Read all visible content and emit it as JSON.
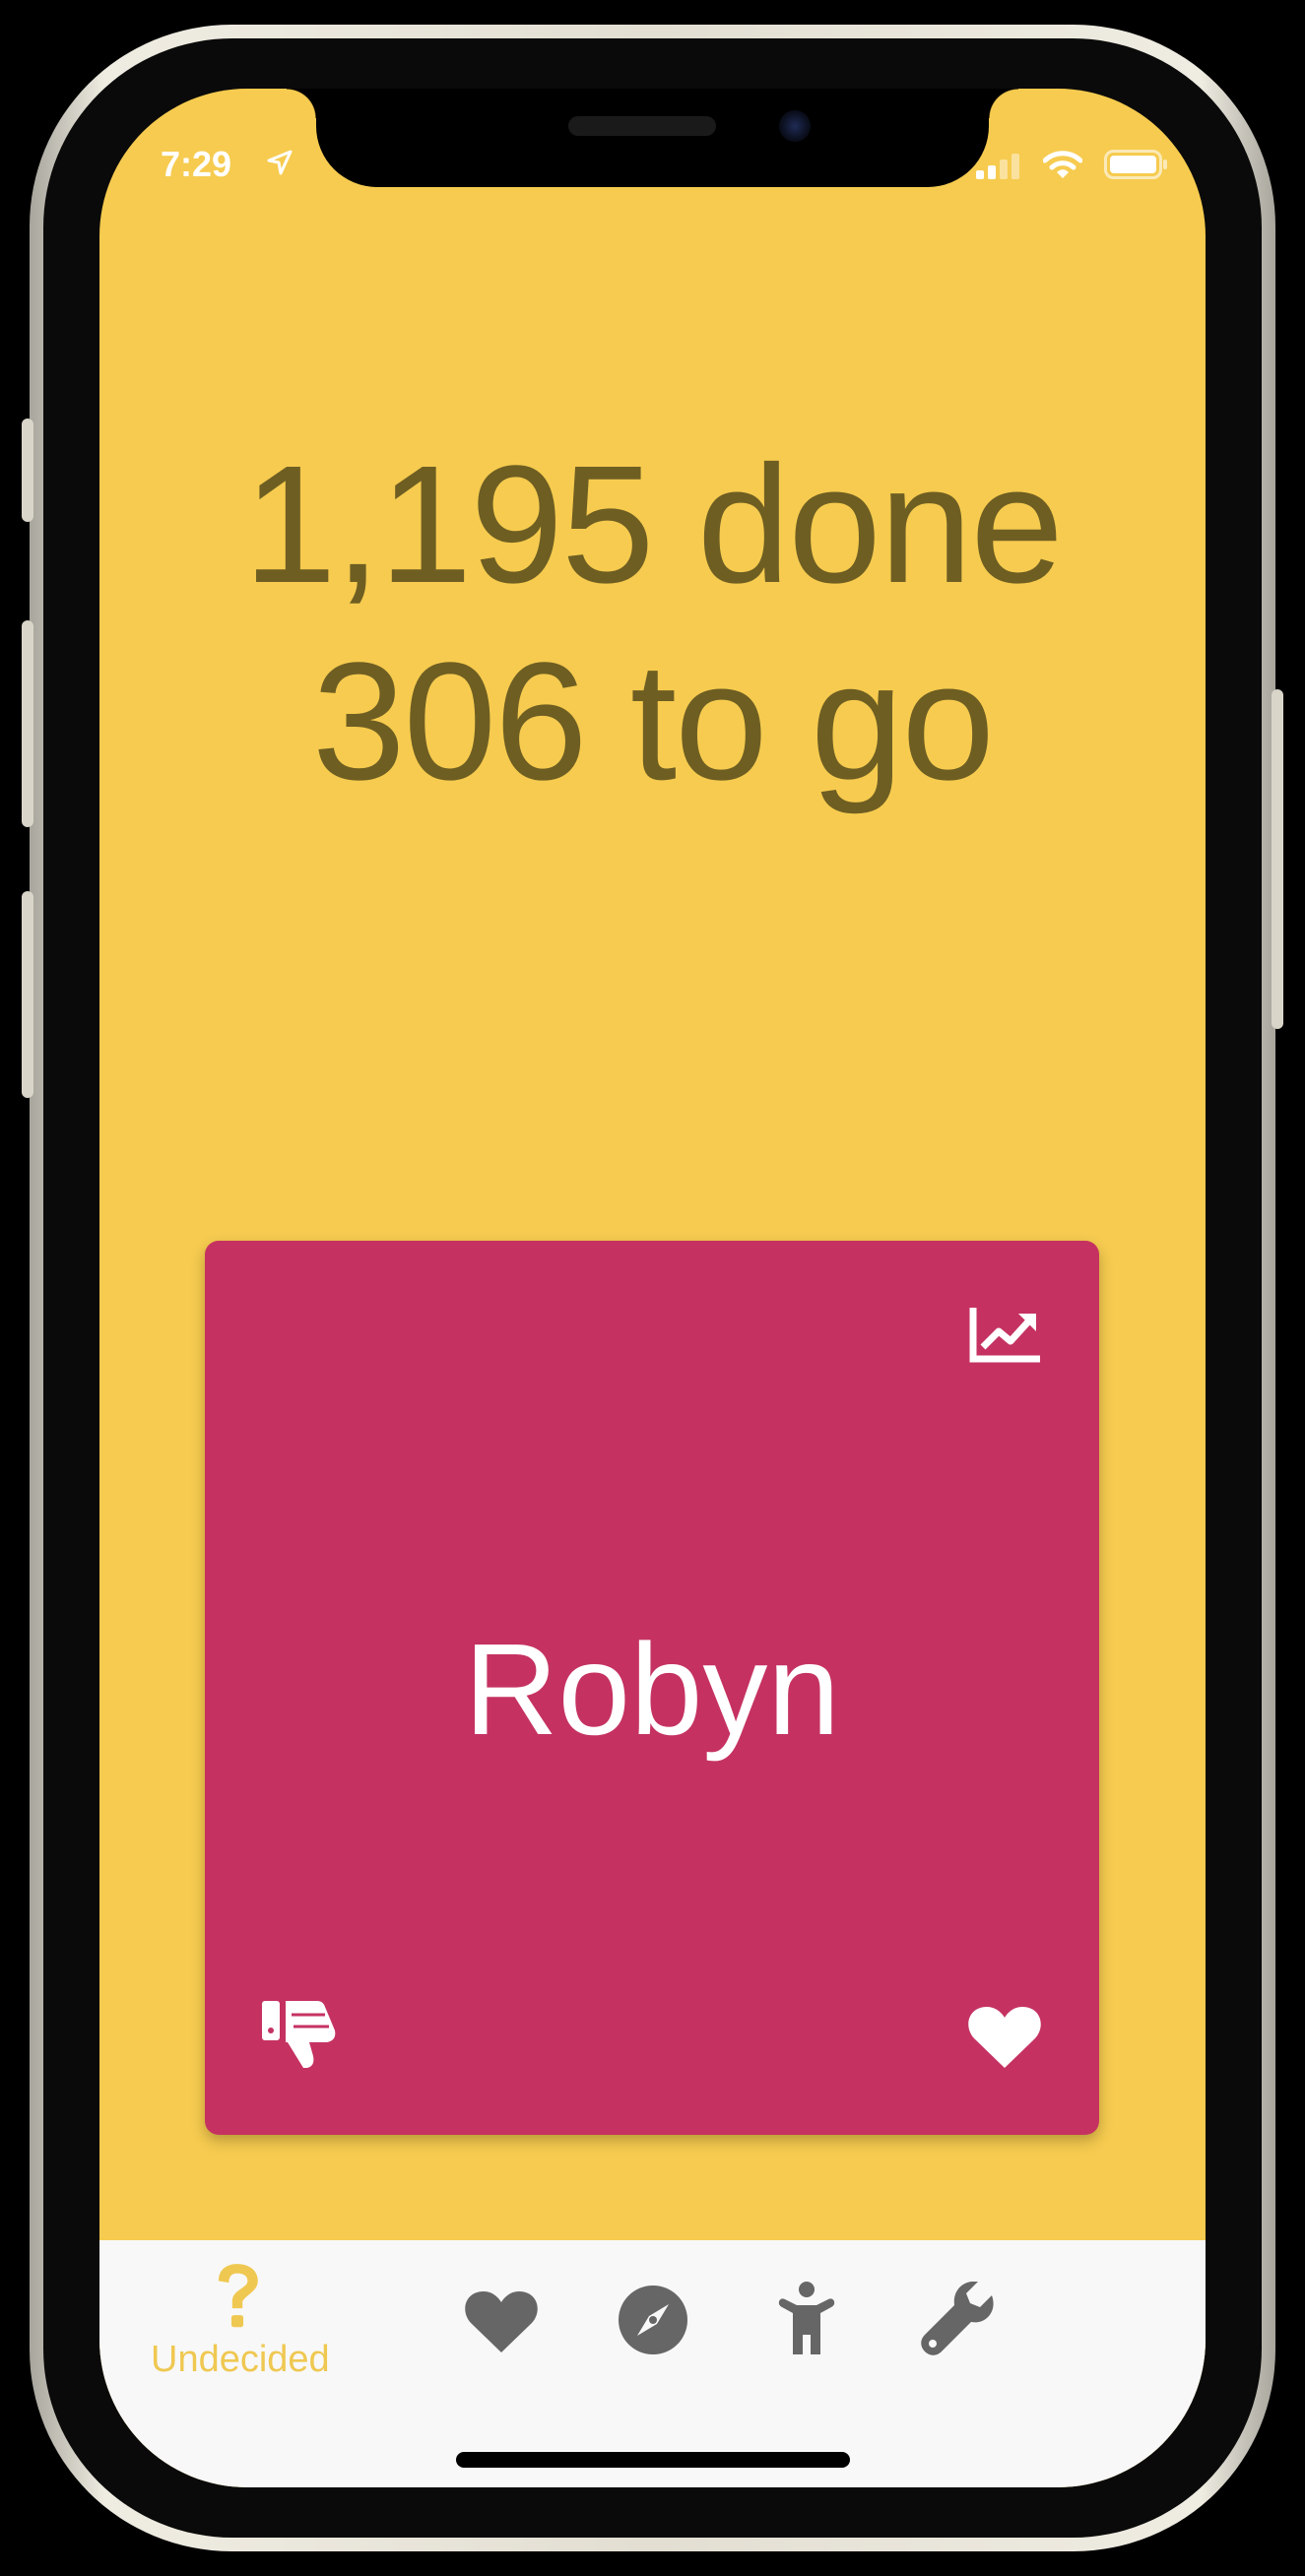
{
  "status_bar": {
    "time": "7:29",
    "icons": [
      "location-arrow-icon",
      "cellular-signal-icon",
      "wifi-icon",
      "battery-icon"
    ]
  },
  "progress": {
    "done_text": "1,195 done",
    "togo_text": "306 to go"
  },
  "card": {
    "name": "Robyn",
    "color": "#c53261",
    "actions": [
      "trending-chart-icon",
      "thumbs-down-icon",
      "heart-icon"
    ]
  },
  "tab_bar": {
    "tabs": [
      {
        "id": "undecided",
        "label": "Undecided",
        "icon": "question-mark-icon",
        "active": true
      },
      {
        "id": "liked",
        "icon": "heart-icon",
        "active": false
      },
      {
        "id": "explore",
        "icon": "compass-icon",
        "active": false
      },
      {
        "id": "profile",
        "icon": "person-icon",
        "active": false
      },
      {
        "id": "settings",
        "icon": "wrench-icon",
        "active": false
      }
    ]
  },
  "colors": {
    "background": "#f6cb4f",
    "headline_text": "#6e5e22",
    "active_tab": "#efc851",
    "inactive_tab": "#666666",
    "tab_bar_bg": "#f8f8f8"
  }
}
